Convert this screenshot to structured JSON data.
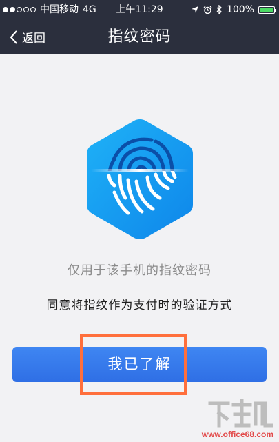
{
  "status_bar": {
    "carrier": "中国移动",
    "network": "4G",
    "time": "上午11:29",
    "battery": "100%"
  },
  "nav": {
    "back_label": "返回",
    "title": "指纹密码"
  },
  "caption": "仅用于该手机的指纹密码",
  "agreement": "同意将指纹作为支付时的验证方式",
  "confirm_button": "我已了解",
  "watermark": {
    "url": "www.office68.com",
    "logo_text": "下载吧"
  },
  "colors": {
    "nav_bg": "#2b2f3d",
    "button": "#3478f0",
    "hexagon": "#1a9bf0",
    "highlight": "#ff6f3c"
  },
  "icons": [
    "back-chevron-icon",
    "location-icon",
    "alarm-icon",
    "bluetooth-icon",
    "battery-icon",
    "fingerprint-icon"
  ]
}
